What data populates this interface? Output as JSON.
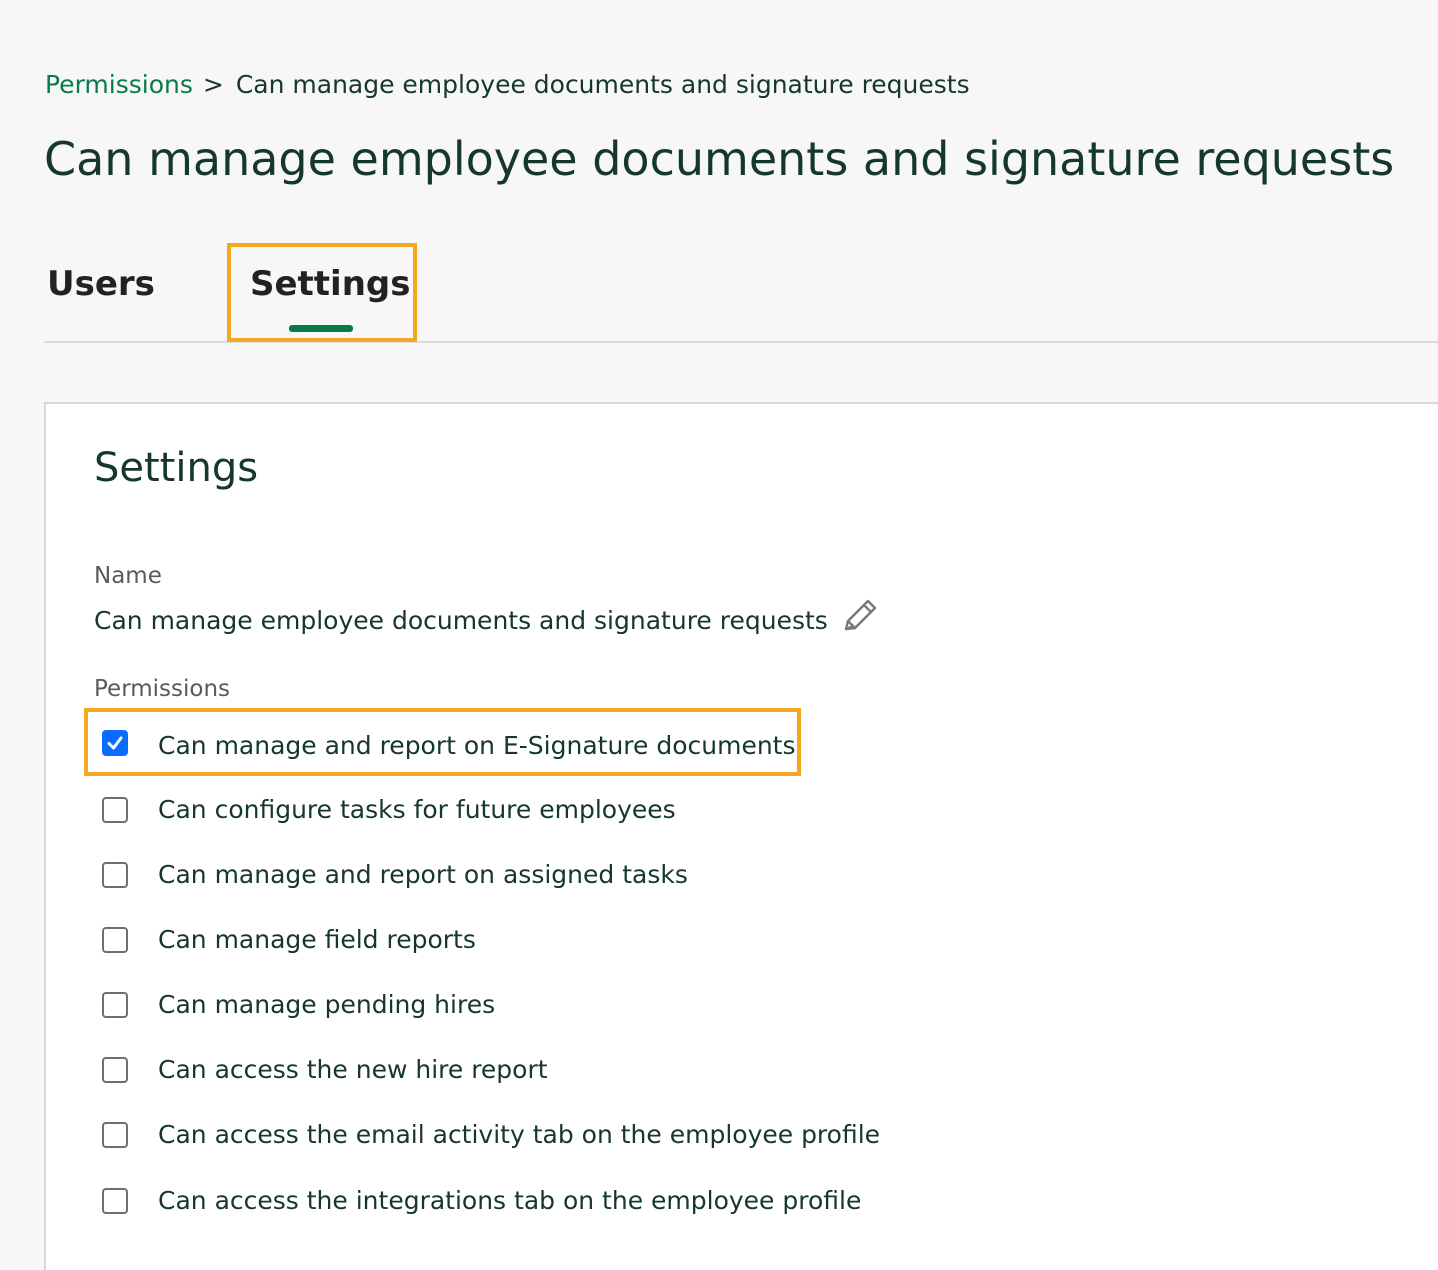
{
  "breadcrumb": {
    "parent": "Permissions",
    "separator": ">",
    "current": "Can manage employee documents and signature requests"
  },
  "page": {
    "title": "Can manage employee documents and signature requests"
  },
  "tabs": [
    {
      "label": "Users",
      "active": false
    },
    {
      "label": "Settings",
      "active": true
    }
  ],
  "settings_card": {
    "title": "Settings",
    "name_label": "Name",
    "name_value": "Can manage employee documents and signature requests",
    "edit_icon": "pencil-icon",
    "permissions_label": "Permissions",
    "permissions": [
      {
        "label": "Can manage and report on E-Signature documents",
        "checked": true
      },
      {
        "label": "Can configure tasks for future employees",
        "checked": false
      },
      {
        "label": "Can manage and report on assigned tasks",
        "checked": false
      },
      {
        "label": "Can manage field reports",
        "checked": false
      },
      {
        "label": "Can manage pending hires",
        "checked": false
      },
      {
        "label": "Can access the new hire report",
        "checked": false
      },
      {
        "label": "Can access the email activity tab on the employee profile",
        "checked": false
      },
      {
        "label": "Can access the integrations tab on the employee profile",
        "checked": false
      }
    ]
  },
  "colors": {
    "accent_green": "#0a7a4a",
    "text_dark": "#15372c",
    "highlight_orange": "#f5a623",
    "checkbox_blue": "#0a6cff"
  }
}
